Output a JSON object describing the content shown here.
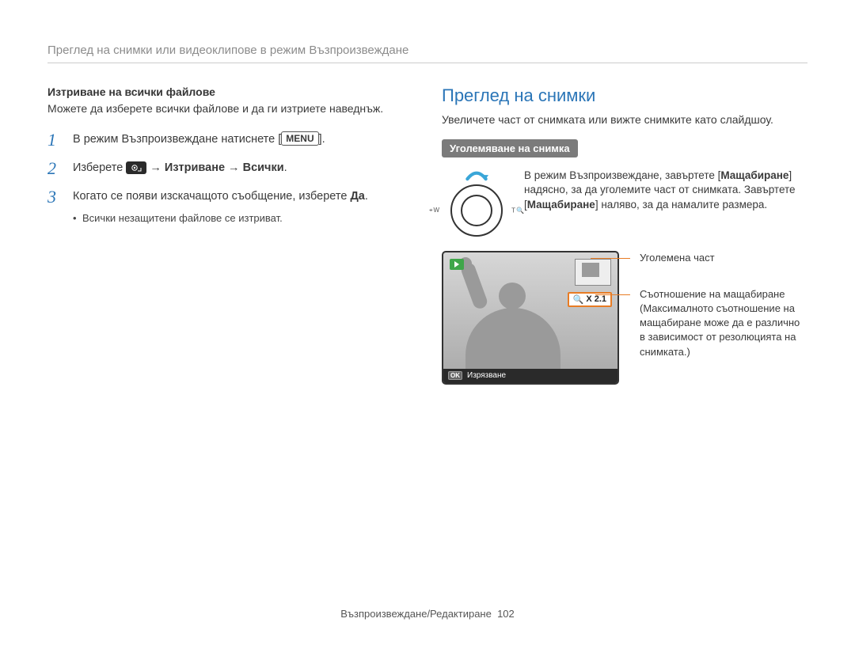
{
  "header": "Преглед на снимки или видеоклипове в режим Възпроизвеждане",
  "left": {
    "sub_heading": "Изтриване на всички файлове",
    "intro": "Можете да изберете всички файлове и да ги изтриете наведнъж.",
    "steps": {
      "s1_pre": "В режим Възпроизвеждане натиснете [",
      "s1_menu": "MENU",
      "s1_post": "].",
      "s2_pre": "Изберете ",
      "s2_arrow1": " → ",
      "s2_b1": "Изтриване",
      "s2_arrow2": " → ",
      "s2_b2": "Всички",
      "s2_post": ".",
      "s3_pre": "Когато се появи изскачащото съобщение, изберете ",
      "s3_b": "Да",
      "s3_post": ".",
      "s3_sub": "Всички незащитени файлове се изтриват."
    },
    "nums": {
      "n1": "1",
      "n2": "2",
      "n3": "3"
    }
  },
  "right": {
    "title": "Преглед на снимки",
    "intro": "Увеличете част от снимката или вижте снимките като слайдшоу.",
    "pill": "Уголемяване на снимка",
    "dial_text_pre": "В режим Възпроизвеждане, завъртете [",
    "dial_b1": "Мащабиране",
    "dial_mid": "] надясно, за да уголемите част от снимката. Завъртете [",
    "dial_b2": "Мащабиране",
    "dial_post": "] наляво, за да намалите размера.",
    "dial_left_icon": "⌖",
    "dial_left_letter": "W",
    "dial_right_letter": "T",
    "dial_right_icon": "🔍",
    "zoom_icon": "🔍",
    "zoom_label": "X 2.1",
    "crop_ok": "OK",
    "crop_label": "Изрязване",
    "callout1": "Уголемена част",
    "callout2": "Съотношение на мащабиране (Максималното съотношение на мащабиране може да е различно в зависимост от резолюцията на снимката.)"
  },
  "footer": {
    "section": "Възпроизвеждане/Редактиране",
    "page": "102"
  }
}
